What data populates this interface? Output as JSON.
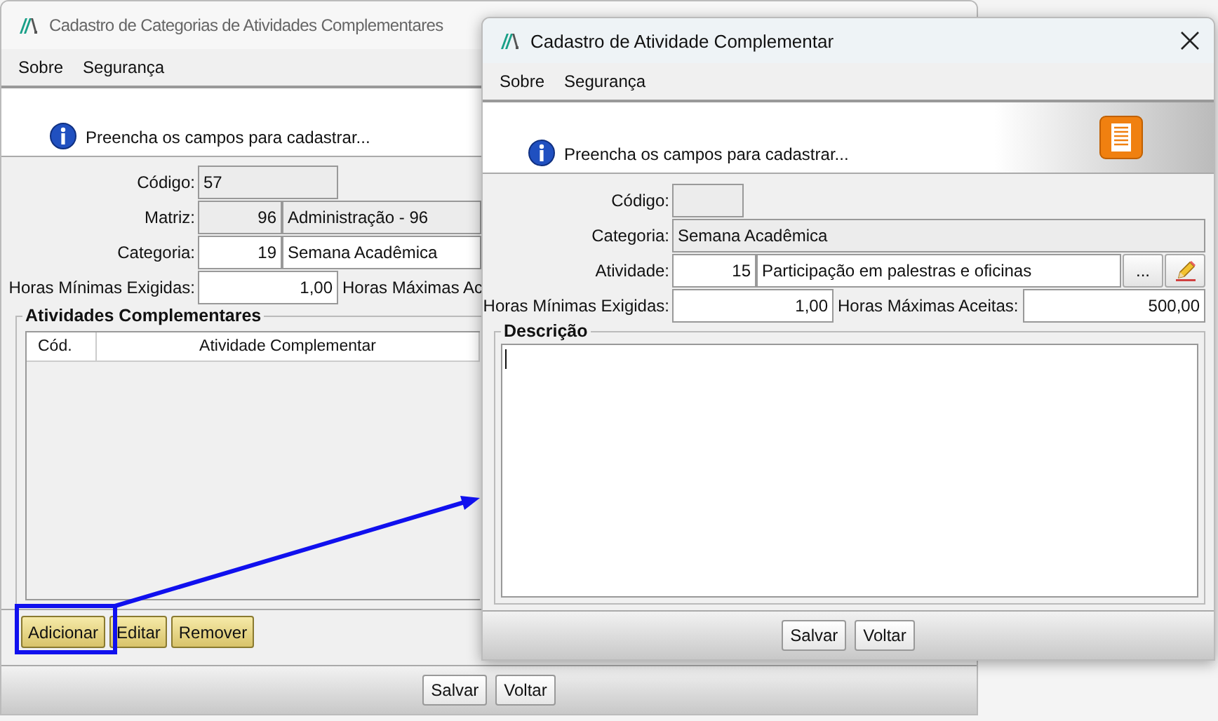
{
  "back_window": {
    "title": "Cadastro de Categorias de Atividades Complementares",
    "menu": [
      "Sobre",
      "Segurança"
    ],
    "info_message": "Preencha os campos para cadastrar...",
    "rows": [
      {
        "kind": "code",
        "label": "Código:",
        "value": "57",
        "readonly": true
      },
      {
        "kind": "pair",
        "label": "Matriz:",
        "code": "96",
        "value": "Administração - 96",
        "readonly": true
      },
      {
        "kind": "pair",
        "label": "Categoria:",
        "code": "19",
        "value": "Semana Acadêmica",
        "readonly": false
      },
      {
        "kind": "hours",
        "label": "Horas Mínimas Exigidas:",
        "value": "1,00",
        "max_label": "Horas Máximas Ac",
        "readonly": false
      }
    ],
    "group_title": "Atividades Complementares",
    "table": {
      "columns": [
        "Cód.",
        "Atividade Complementar"
      ]
    },
    "group_buttons": [
      "Adicionar",
      "Editar",
      "Remover"
    ],
    "buttons": [
      "Salvar",
      "Voltar"
    ]
  },
  "front_window": {
    "title": "Cadastro de Atividade Complementar",
    "menu": [
      "Sobre",
      "Segurança"
    ],
    "info_message": "Preencha os campos para cadastrar...",
    "rows": [
      {
        "kind": "code",
        "label": "Código:",
        "readonly": true
      },
      {
        "kind": "wide",
        "label": "Categoria:",
        "value": "Semana Acadêmica",
        "readonly": true
      },
      {
        "kind": "pair_lookup",
        "label": "Atividade:",
        "code": "15",
        "value": "Participação em palestras e oficinas",
        "lookup_button": "...",
        "readonly": false
      },
      {
        "kind": "hours",
        "label": "Horas Mínimas Exigidas:",
        "value": "1,00",
        "max_label": "Horas Máximas Aceitas:",
        "max_value": "500,00",
        "readonly": false
      }
    ],
    "group_title": "Descrição",
    "buttons": [
      "Salvar",
      "Voltar"
    ]
  }
}
